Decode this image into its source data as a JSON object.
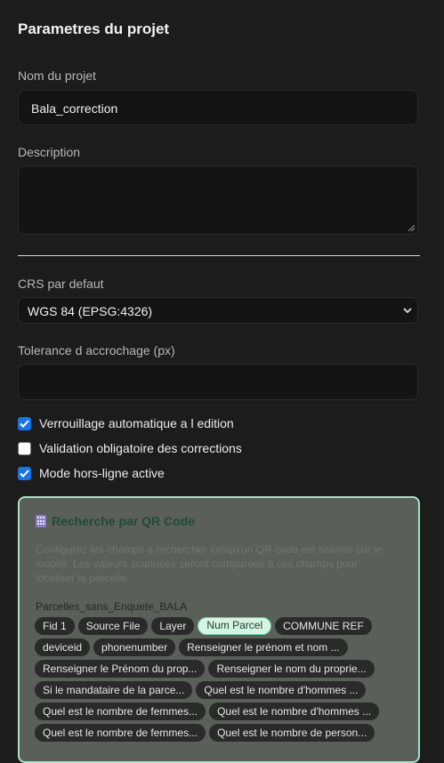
{
  "settings": {
    "title": "Parametres du projet",
    "project_name": {
      "label": "Nom du projet",
      "value": "Bala_correction"
    },
    "description": {
      "label": "Description",
      "value": ""
    },
    "crs": {
      "label": "CRS par defaut",
      "value": "WGS 84 (EPSG:4326)"
    },
    "tolerance": {
      "label": "Tolerance d accrochage (px)",
      "value": ""
    },
    "options": [
      {
        "label": "Verrouillage automatique a l edition",
        "checked": true
      },
      {
        "label": "Validation obligatoire des corrections",
        "checked": false
      },
      {
        "label": "Mode hors-ligne active",
        "checked": true
      }
    ]
  },
  "qr": {
    "title": "Recherche par QR Code",
    "description": "Configurez les champs a rechercher lorsqu'un QR code est scanné sur le mobile. Les valeurs scannées seront comparées à ces champs pour localiser la parcelle.",
    "layer": "Parcelles_sans_Enquete_BALA",
    "chips": [
      [
        "Fid 1",
        "Source File",
        "Layer",
        "Num Parcel",
        "COMMUNE REF"
      ],
      [
        "deviceid",
        "phonenumber",
        "Renseigner le prénom et nom ..."
      ],
      [
        "Renseigner le Prénom du prop...",
        "Renseigner le nom du proprie..."
      ],
      [
        "Si le mandataire de la parce...",
        "Quel est le nombre d'hommes ..."
      ],
      [
        "Quel est le nombre de femmes...",
        "Quel est le nombre d'hommes ..."
      ],
      [
        "Quel est le nombre de femmes...",
        "Quel est le nombre de person..."
      ]
    ],
    "selected_chip": "Num Parcel"
  }
}
